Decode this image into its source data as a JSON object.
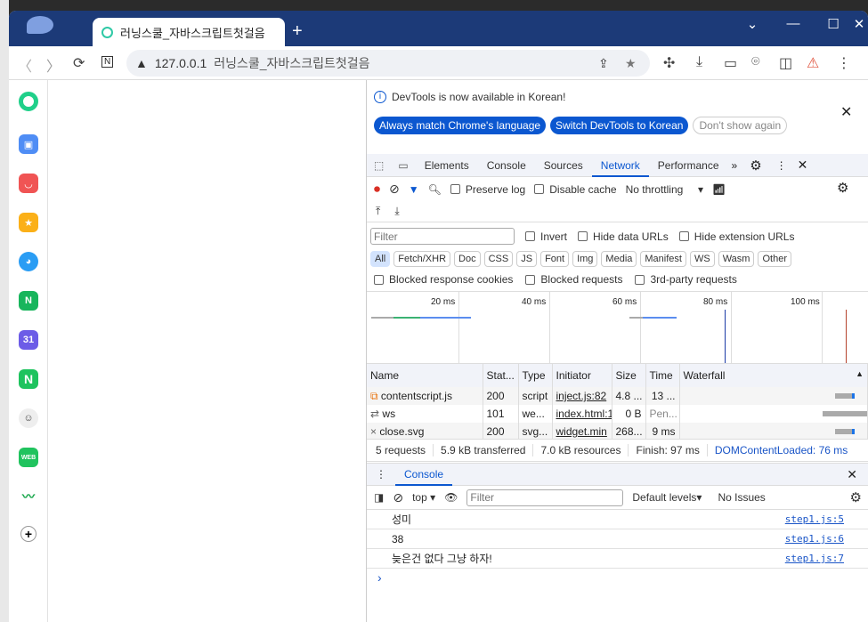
{
  "browser": {
    "tab_title": "러닝스쿨_자바스크립트첫걸음",
    "address_host": "127.0.0.1",
    "address_title": "러닝스쿨_자바스크립트첫걸음"
  },
  "devtools": {
    "banner": {
      "text": "DevTools is now available in Korean!",
      "btn_match": "Always match Chrome's language",
      "btn_switch": "Switch DevTools to Korean",
      "btn_dont": "Don't show again"
    },
    "tabs": [
      "Elements",
      "Console",
      "Sources",
      "Network",
      "Performance"
    ],
    "active_tab": "Network",
    "network": {
      "preserve_log": "Preserve log",
      "disable_cache": "Disable cache",
      "throttling": "No throttling",
      "filter_placeholder": "Filter",
      "invert": "Invert",
      "hide_data": "Hide data URLs",
      "hide_ext": "Hide extension URLs",
      "types": [
        "All",
        "Fetch/XHR",
        "Doc",
        "CSS",
        "JS",
        "Font",
        "Img",
        "Media",
        "Manifest",
        "WS",
        "Wasm",
        "Other"
      ],
      "blocked_cookies": "Blocked response cookies",
      "blocked_requests": "Blocked requests",
      "third_party": "3rd-party requests",
      "timeline_ticks": [
        "20 ms",
        "40 ms",
        "60 ms",
        "80 ms",
        "100 ms"
      ],
      "columns": [
        "Name",
        "Stat...",
        "Type",
        "Initiator",
        "Size",
        "Time",
        "Waterfall"
      ],
      "rows": [
        {
          "icon": "script",
          "name": "contentscript.js",
          "status": "200",
          "type": "script",
          "initiator": "inject.js:82",
          "size": "4.8 ...",
          "time": "13 ..."
        },
        {
          "icon": "websocket",
          "name": "ws",
          "status": "101",
          "type": "we...",
          "initiator": "index.html:1",
          "size": "0 B",
          "time": "Pen..."
        },
        {
          "icon": "close",
          "name": "close.svg",
          "status": "200",
          "type": "svg...",
          "initiator": "widget.min",
          "size": "268...",
          "time": "9 ms"
        }
      ],
      "summary": {
        "requests": "5 requests",
        "transferred": "5.9 kB transferred",
        "resources": "7.0 kB resources",
        "finish": "Finish: 97 ms",
        "dcl": "DOMContentLoaded: 76 ms"
      }
    },
    "console": {
      "title": "Console",
      "context": "top",
      "filter_placeholder": "Filter",
      "levels": "Default levels",
      "issues": "No Issues",
      "logs": [
        {
          "text": "성미",
          "source": "step1.js:5"
        },
        {
          "text": "38",
          "source": "step1.js:6"
        },
        {
          "text": "늦은건 없다 그냥 하자!",
          "source": "step1.js:7"
        }
      ],
      "prompt": "›"
    }
  }
}
